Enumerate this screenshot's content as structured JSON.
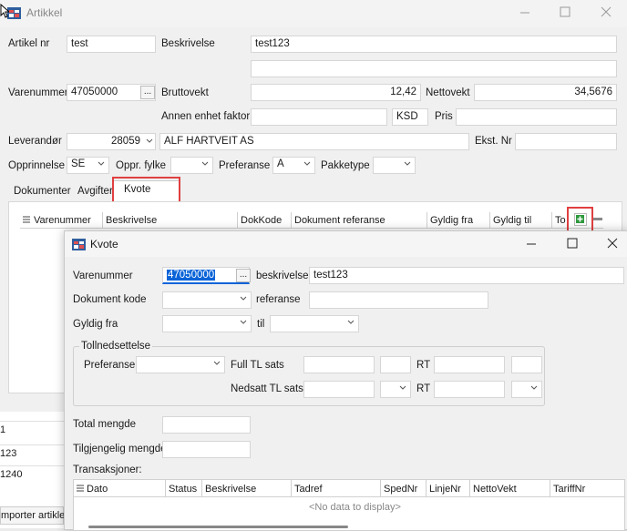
{
  "main_window": {
    "title": "Artikkel",
    "fields": {
      "artikel_nr_label": "Artikel nr",
      "artikel_nr": "test",
      "beskrivelse_label": "Beskrivelse",
      "beskrivelse": "test123",
      "varenummer_label": "Varenummer",
      "varenummer": "47050000",
      "ellipsis": "...",
      "bruttovekt_label": "Bruttovekt",
      "bruttovekt": "12,42",
      "nettovekt_label": "Nettovekt",
      "nettovekt": "34,5676",
      "annen_enhet_label": "Annen enhet faktor",
      "ksd": "KSD",
      "pris_label": "Pris",
      "leverandor_label": "Leverandør",
      "leverandor_id": "28059",
      "leverandor_name": "ALF HARTVEIT AS",
      "ekst_nr_label": "Ekst. Nr",
      "opprinnelse_label": "Opprinnelse",
      "opprinnelse": "SE",
      "oppr_fylke_label": "Oppr. fylke",
      "preferanse_label": "Preferanse",
      "preferanse": "A",
      "pakketype_label": "Pakketype"
    },
    "tabs": [
      "Dokumenter",
      "Avgifter",
      "Kvote"
    ],
    "grid_columns": [
      "Varenummer",
      "Beskrivelse",
      "DokKode",
      "Dokument referanse",
      "Gyldig fra",
      "Gyldig til",
      "To"
    ],
    "left_list": [
      "1",
      "123",
      "1240"
    ],
    "left_list_header": "",
    "importer_label": "mporter artikler"
  },
  "dialog": {
    "title": "Kvote",
    "varenummer_label": "Varenummer",
    "varenummer": "47050000",
    "ellipsis": "...",
    "beskrivelse_label": "beskrivelse",
    "beskrivelse": "test123",
    "dokument_kode_label": "Dokument kode",
    "referanse_label": "referanse",
    "gyldig_fra_label": "Gyldig fra",
    "til_label": "til",
    "tollnedsettelse_label": "Tollnedsettelse",
    "preferanse_label": "Preferanse",
    "full_tl_sats_label": "Full TL sats",
    "rt_label": "RT",
    "nedsatt_tl_sats_label": "Nedsatt TL sats",
    "rt2_label": "RT",
    "total_mengde_label": "Total mengde",
    "tilgjengelig_mengde_label": "Tilgjengelig mengde",
    "transaksjoner_label": "Transaksjoner:",
    "columns": [
      "Dato",
      "Status",
      "Beskrivelse",
      "Tadref",
      "SpedNr",
      "LinjeNr",
      "NettoVekt",
      "TariffNr"
    ],
    "empty_text": "<No data to display>"
  },
  "colors": {
    "highlight_red": "#e04040",
    "selection_blue": "#0a64d8"
  }
}
